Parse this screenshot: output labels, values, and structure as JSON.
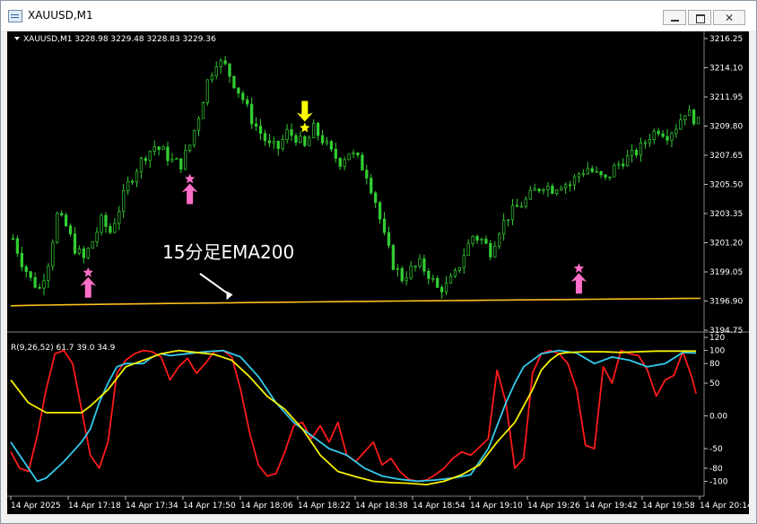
{
  "window": {
    "title": "XAUUSD,M1"
  },
  "colors": {
    "background": "#000000",
    "candles": "#32cd32",
    "ema": "#ffc020",
    "annotation": "#ffffff",
    "rci_short": "#ff1a1a",
    "rci_mid": "#33ccee",
    "rci_long": "#f5f000",
    "signal_buy": "#ff6ec7",
    "signal_sell": "#ffff00"
  },
  "chart_data": [
    {
      "type": "candlestick",
      "header": "XAUUSD,M1  3228.98 3229.48 3228.83 3229.36",
      "symbol": "XAUUSD,M1",
      "ohlc_readout": [
        3228.98,
        3229.48,
        3228.83,
        3229.36
      ],
      "y_ticks": [
        "3216.25",
        "3214.10",
        "3211.95",
        "3209.80",
        "3207.65",
        "3205.50",
        "3203.35",
        "3201.20",
        "3199.05",
        "3196.90",
        "3194.75"
      ],
      "ylim": [
        3194.75,
        3216.25
      ],
      "x_ticks": [
        "14 Apr 2025",
        "14 Apr 17:18",
        "14 Apr 17:34",
        "14 Apr 17:50",
        "14 Apr 18:06",
        "14 Apr 18:22",
        "14 Apr 18:38",
        "14 Apr 18:54",
        "14 Apr 19:10",
        "14 Apr 19:26",
        "14 Apr 19:42",
        "14 Apr 19:58",
        "14 Apr 20:14"
      ],
      "close_path": [
        [
          0,
          3201.5
        ],
        [
          2,
          3199.8
        ],
        [
          4,
          3198.5
        ],
        [
          6,
          3197.8
        ],
        [
          8,
          3199.8
        ],
        [
          10,
          3203.2
        ],
        [
          12,
          3202.4
        ],
        [
          14,
          3200.8
        ],
        [
          16,
          3200.0
        ],
        [
          18,
          3201.3
        ],
        [
          20,
          3202.8
        ],
        [
          22,
          3202.0
        ],
        [
          24,
          3203.7
        ],
        [
          26,
          3205.5
        ],
        [
          28,
          3206.7
        ],
        [
          30,
          3207.7
        ],
        [
          32,
          3208.3
        ],
        [
          34,
          3207.9
        ],
        [
          36,
          3207.2
        ],
        [
          38,
          3207.0
        ],
        [
          40,
          3208.4
        ],
        [
          42,
          3210.6
        ],
        [
          44,
          3213.1
        ],
        [
          46,
          3214.6
        ],
        [
          48,
          3214.2
        ],
        [
          50,
          3213.0
        ],
        [
          52,
          3211.8
        ],
        [
          54,
          3210.3
        ],
        [
          56,
          3209.3
        ],
        [
          58,
          3208.3
        ],
        [
          60,
          3208.2
        ],
        [
          62,
          3209.3
        ],
        [
          64,
          3209.0
        ],
        [
          66,
          3208.2
        ],
        [
          68,
          3209.6
        ],
        [
          70,
          3208.8
        ],
        [
          72,
          3207.8
        ],
        [
          74,
          3207.2
        ],
        [
          76,
          3207.9
        ],
        [
          78,
          3207.3
        ],
        [
          80,
          3206.3
        ],
        [
          82,
          3204.3
        ],
        [
          84,
          3201.6
        ],
        [
          86,
          3199.6
        ],
        [
          88,
          3198.6
        ],
        [
          90,
          3199.2
        ],
        [
          92,
          3199.6
        ],
        [
          94,
          3198.9
        ],
        [
          96,
          3197.8
        ],
        [
          98,
          3198.0
        ],
        [
          100,
          3198.8
        ],
        [
          102,
          3200.4
        ],
        [
          104,
          3201.7
        ],
        [
          106,
          3201.4
        ],
        [
          108,
          3200.6
        ],
        [
          110,
          3202.2
        ],
        [
          112,
          3203.2
        ],
        [
          114,
          3203.8
        ],
        [
          116,
          3204.3
        ],
        [
          118,
          3205.0
        ],
        [
          120,
          3205.5
        ],
        [
          122,
          3205.2
        ],
        [
          124,
          3205.6
        ],
        [
          126,
          3205.5
        ],
        [
          128,
          3206.3
        ],
        [
          130,
          3206.7
        ],
        [
          132,
          3206.2
        ],
        [
          134,
          3205.8
        ],
        [
          136,
          3206.7
        ],
        [
          138,
          3207.3
        ],
        [
          140,
          3207.6
        ],
        [
          142,
          3208.2
        ],
        [
          144,
          3209.1
        ],
        [
          146,
          3209.6
        ],
        [
          148,
          3209.2
        ],
        [
          150,
          3209.8
        ],
        [
          152,
          3210.9
        ],
        [
          154,
          3210.4
        ],
        [
          155,
          3210.0
        ]
      ],
      "ema": {
        "label": "15分足EMA200",
        "start": 3196.55,
        "end": 3197.1,
        "arrow_to_bar": 49,
        "value_at_arrow": 3196.78
      },
      "signals": [
        {
          "type": "buy",
          "bar": 17,
          "price": 3199.0
        },
        {
          "type": "buy",
          "bar": 40,
          "price": 3205.9
        },
        {
          "type": "sell",
          "bar": 66,
          "price": 3209.6
        },
        {
          "type": "buy",
          "bar": 128,
          "price": 3199.3
        }
      ]
    },
    {
      "type": "line",
      "header": "R(9,26,52) 61.7 39.0 34.9",
      "name": "R(9,26,52)",
      "current_values": [
        61.7,
        39.0,
        34.9
      ],
      "y_ticks": [
        "120",
        "100",
        "80",
        "50",
        "0.00",
        "-50",
        "-80",
        "-100"
      ],
      "ylim": [
        -120,
        120
      ],
      "series": [
        {
          "name": "9",
          "color": "#ff1a1a",
          "points": [
            [
              0,
              -55
            ],
            [
              2,
              -80
            ],
            [
              4,
              -85
            ],
            [
              6,
              -30
            ],
            [
              8,
              40
            ],
            [
              10,
              95
            ],
            [
              12,
              100
            ],
            [
              14,
              80
            ],
            [
              16,
              10
            ],
            [
              18,
              -60
            ],
            [
              20,
              -80
            ],
            [
              22,
              -40
            ],
            [
              24,
              65
            ],
            [
              26,
              85
            ],
            [
              28,
              95
            ],
            [
              30,
              100
            ],
            [
              32,
              98
            ],
            [
              34,
              90
            ],
            [
              36,
              55
            ],
            [
              38,
              75
            ],
            [
              40,
              88
            ],
            [
              42,
              65
            ],
            [
              44,
              80
            ],
            [
              46,
              98
            ],
            [
              48,
              100
            ],
            [
              50,
              90
            ],
            [
              52,
              40
            ],
            [
              54,
              -25
            ],
            [
              56,
              -75
            ],
            [
              58,
              -92
            ],
            [
              60,
              -88
            ],
            [
              62,
              -55
            ],
            [
              64,
              -15
            ],
            [
              66,
              -10
            ],
            [
              68,
              -35
            ],
            [
              70,
              -15
            ],
            [
              72,
              -40
            ],
            [
              74,
              -10
            ],
            [
              76,
              -60
            ],
            [
              78,
              -70
            ],
            [
              80,
              -55
            ],
            [
              82,
              -40
            ],
            [
              84,
              -75
            ],
            [
              86,
              -65
            ],
            [
              88,
              -85
            ],
            [
              90,
              -97
            ],
            [
              92,
              -100
            ],
            [
              94,
              -98
            ],
            [
              96,
              -90
            ],
            [
              98,
              -80
            ],
            [
              100,
              -65
            ],
            [
              102,
              -55
            ],
            [
              104,
              -60
            ],
            [
              106,
              -48
            ],
            [
              108,
              -35
            ],
            [
              110,
              70
            ],
            [
              112,
              20
            ],
            [
              114,
              -80
            ],
            [
              116,
              -65
            ],
            [
              118,
              65
            ],
            [
              120,
              95
            ],
            [
              122,
              100
            ],
            [
              124,
              95
            ],
            [
              126,
              80
            ],
            [
              128,
              40
            ],
            [
              130,
              -45
            ],
            [
              132,
              -50
            ],
            [
              134,
              75
            ],
            [
              136,
              50
            ],
            [
              138,
              100
            ],
            [
              140,
              95
            ],
            [
              142,
              92
            ],
            [
              144,
              70
            ],
            [
              146,
              30
            ],
            [
              148,
              55
            ],
            [
              150,
              62
            ],
            [
              152,
              98
            ],
            [
              154,
              60
            ],
            [
              155,
              34
            ]
          ]
        },
        {
          "name": "26",
          "color": "#33ccee",
          "points": [
            [
              0,
              -40
            ],
            [
              4,
              -80
            ],
            [
              6,
              -100
            ],
            [
              8,
              -95
            ],
            [
              12,
              -70
            ],
            [
              16,
              -40
            ],
            [
              18,
              -20
            ],
            [
              20,
              20
            ],
            [
              22,
              50
            ],
            [
              24,
              75
            ],
            [
              26,
              80
            ],
            [
              30,
              80
            ],
            [
              32,
              90
            ],
            [
              34,
              95
            ],
            [
              36,
              92
            ],
            [
              40,
              95
            ],
            [
              44,
              98
            ],
            [
              48,
              100
            ],
            [
              52,
              90
            ],
            [
              56,
              60
            ],
            [
              60,
              20
            ],
            [
              64,
              -10
            ],
            [
              68,
              -30
            ],
            [
              72,
              -50
            ],
            [
              76,
              -60
            ],
            [
              80,
              -80
            ],
            [
              84,
              -92
            ],
            [
              88,
              -97
            ],
            [
              92,
              -100
            ],
            [
              96,
              -98
            ],
            [
              100,
              -95
            ],
            [
              104,
              -90
            ],
            [
              108,
              -50
            ],
            [
              112,
              20
            ],
            [
              114,
              50
            ],
            [
              116,
              75
            ],
            [
              120,
              95
            ],
            [
              124,
              100
            ],
            [
              128,
              96
            ],
            [
              132,
              80
            ],
            [
              136,
              90
            ],
            [
              140,
              85
            ],
            [
              144,
              75
            ],
            [
              148,
              80
            ],
            [
              152,
              97
            ],
            [
              155,
              96
            ]
          ]
        },
        {
          "name": "52",
          "color": "#f5f000",
          "points": [
            [
              0,
              55
            ],
            [
              4,
              20
            ],
            [
              8,
              5
            ],
            [
              12,
              5
            ],
            [
              16,
              5
            ],
            [
              18,
              15
            ],
            [
              22,
              40
            ],
            [
              26,
              75
            ],
            [
              30,
              85
            ],
            [
              34,
              95
            ],
            [
              38,
              100
            ],
            [
              42,
              97
            ],
            [
              46,
              94
            ],
            [
              50,
              85
            ],
            [
              54,
              60
            ],
            [
              58,
              30
            ],
            [
              62,
              10
            ],
            [
              66,
              -20
            ],
            [
              70,
              -60
            ],
            [
              74,
              -85
            ],
            [
              78,
              -93
            ],
            [
              82,
              -100
            ],
            [
              86,
              -102
            ],
            [
              90,
              -103
            ],
            [
              94,
              -105
            ],
            [
              98,
              -100
            ],
            [
              102,
              -90
            ],
            [
              106,
              -75
            ],
            [
              110,
              -40
            ],
            [
              114,
              -10
            ],
            [
              118,
              40
            ],
            [
              120,
              70
            ],
            [
              122,
              85
            ],
            [
              124,
              95
            ],
            [
              126,
              97
            ],
            [
              130,
              98
            ],
            [
              134,
              98
            ],
            [
              138,
              97
            ],
            [
              142,
              98
            ],
            [
              146,
              99
            ],
            [
              150,
              99
            ],
            [
              155,
              99
            ]
          ]
        }
      ]
    }
  ]
}
